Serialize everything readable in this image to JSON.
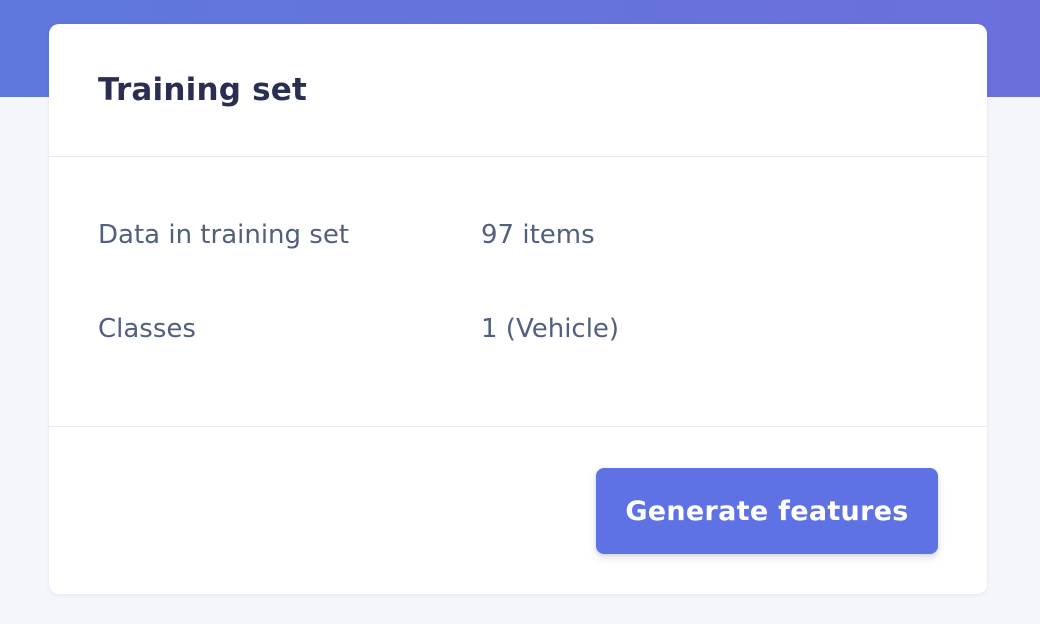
{
  "card": {
    "title": "Training set",
    "rows": [
      {
        "label": "Data in training set",
        "value": "97 items"
      },
      {
        "label": "Classes",
        "value": "1 (Vehicle)"
      }
    ],
    "button_label": "Generate features"
  },
  "colors": {
    "header_band": "#6274dd",
    "primary_button": "#5e72e4",
    "title_text": "#2a2e52",
    "body_text": "#525f7f"
  }
}
